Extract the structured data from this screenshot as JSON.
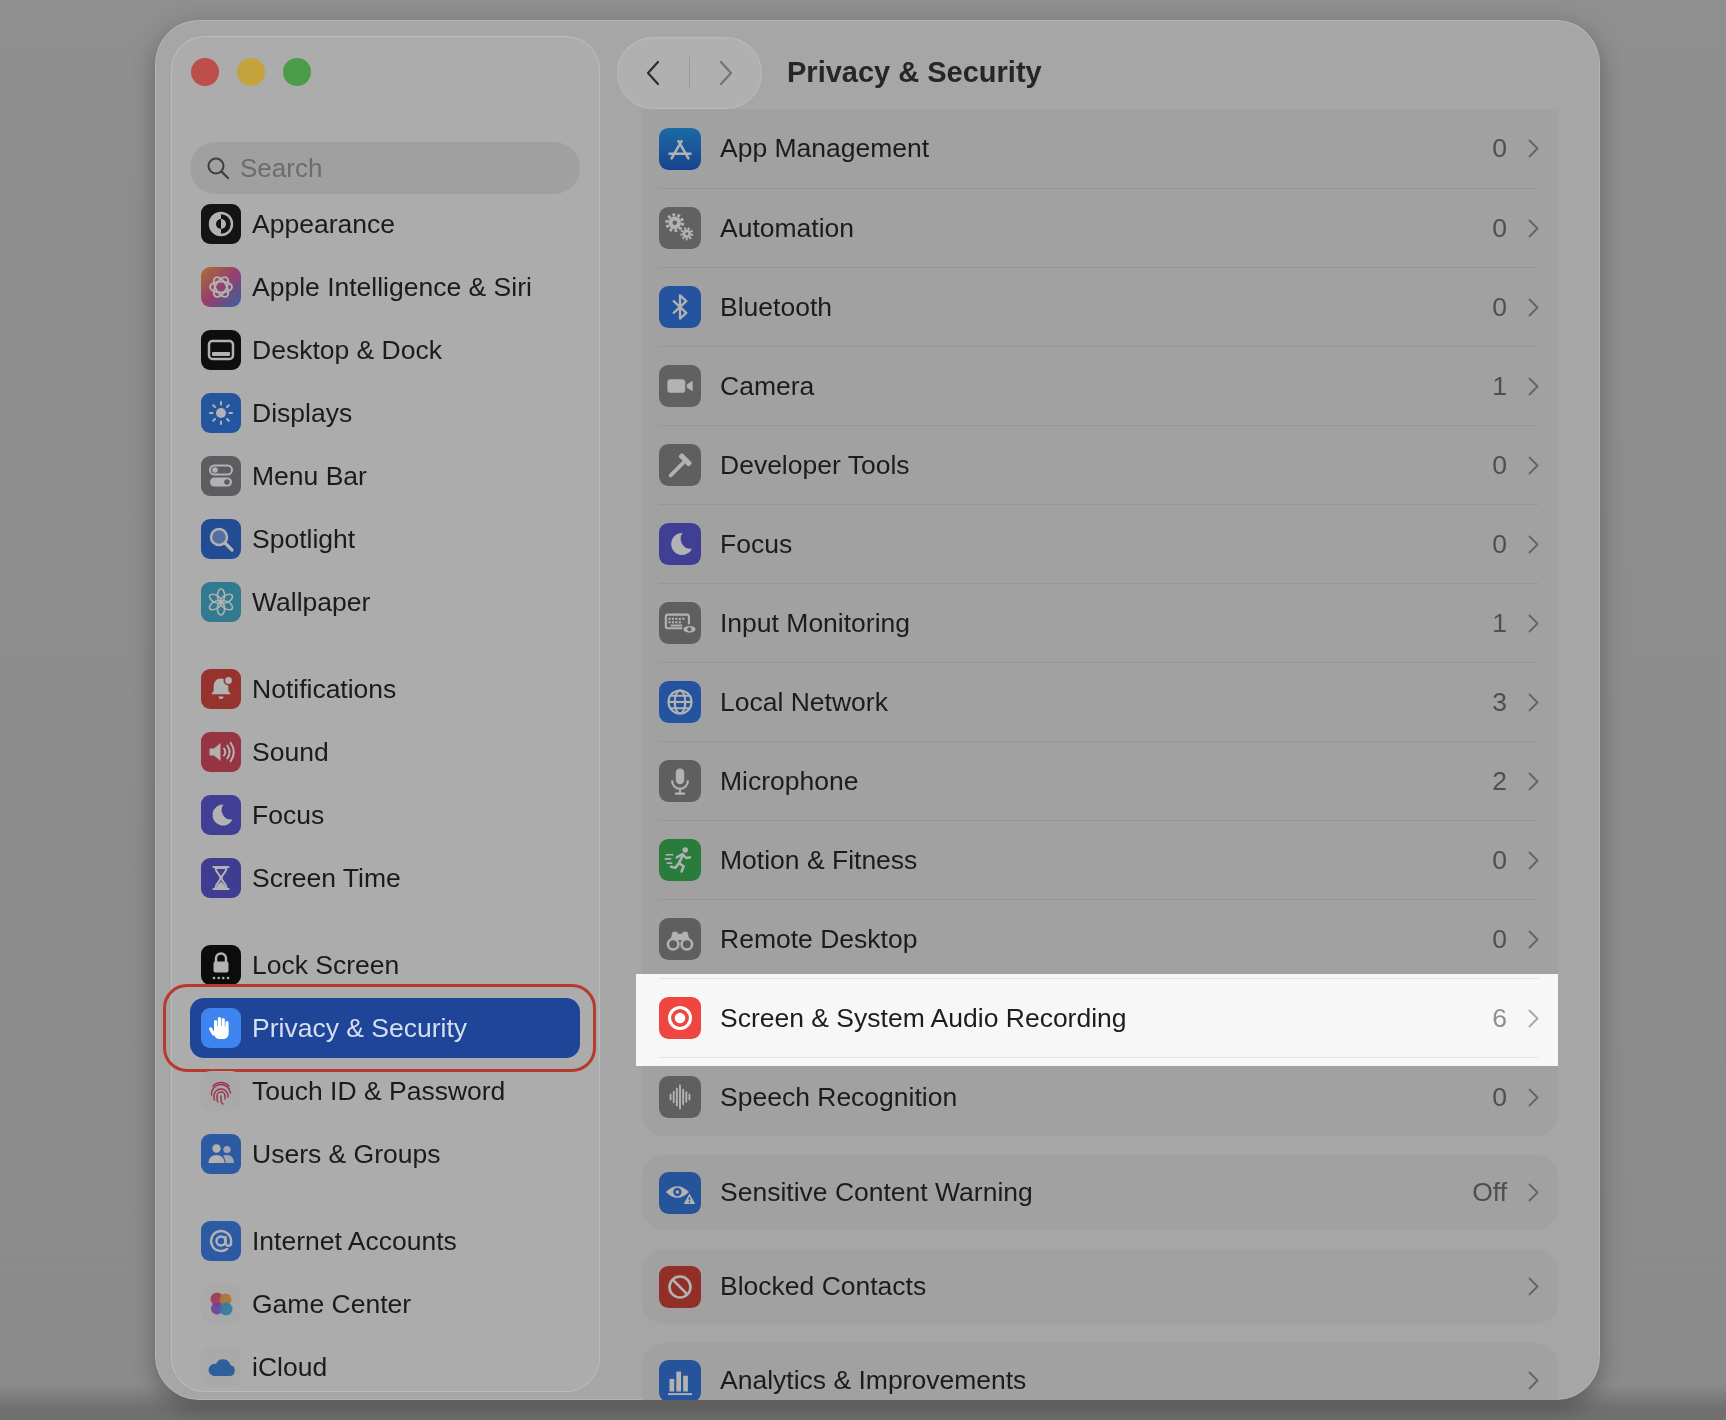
{
  "window": {
    "title": "Privacy & Security"
  },
  "nav": {
    "back_disabled": false,
    "forward_disabled": true
  },
  "sidebar": {
    "search": {
      "placeholder": "Search"
    },
    "groups": [
      {
        "items": [
          {
            "label": "Appearance",
            "selected": false,
            "circled": false
          },
          {
            "label": "Apple Intelligence & Siri",
            "selected": false,
            "circled": false
          },
          {
            "label": "Desktop & Dock",
            "selected": false,
            "circled": false
          },
          {
            "label": "Displays",
            "selected": false,
            "circled": false
          },
          {
            "label": "Menu Bar",
            "selected": false,
            "circled": false
          },
          {
            "label": "Spotlight",
            "selected": false,
            "circled": false
          },
          {
            "label": "Wallpaper",
            "selected": false,
            "circled": false
          }
        ]
      },
      {
        "items": [
          {
            "label": "Notifications",
            "selected": false,
            "circled": false
          },
          {
            "label": "Sound",
            "selected": false,
            "circled": false
          },
          {
            "label": "Focus",
            "selected": false,
            "circled": false
          },
          {
            "label": "Screen Time",
            "selected": false,
            "circled": false
          }
        ]
      },
      {
        "items": [
          {
            "label": "Lock Screen",
            "selected": false,
            "circled": false
          },
          {
            "label": "Privacy & Security",
            "selected": true,
            "circled": true
          },
          {
            "label": "Touch ID & Password",
            "selected": false,
            "circled": false
          },
          {
            "label": "Users & Groups",
            "selected": false,
            "circled": false
          }
        ]
      },
      {
        "items": [
          {
            "label": "Internet Accounts",
            "selected": false,
            "circled": false
          },
          {
            "label": "Game Center",
            "selected": false,
            "circled": false
          },
          {
            "label": "iCloud",
            "selected": false,
            "circled": false
          }
        ]
      }
    ]
  },
  "content": {
    "sections": [
      {
        "rows": [
          {
            "label": "App Management",
            "value": "0",
            "highlighted": false
          },
          {
            "label": "Automation",
            "value": "0",
            "highlighted": false
          },
          {
            "label": "Bluetooth",
            "value": "0",
            "highlighted": false
          },
          {
            "label": "Camera",
            "value": "1",
            "highlighted": false
          },
          {
            "label": "Developer Tools",
            "value": "0",
            "highlighted": false
          },
          {
            "label": "Focus",
            "value": "0",
            "highlighted": false
          },
          {
            "label": "Input Monitoring",
            "value": "1",
            "highlighted": false
          },
          {
            "label": "Local Network",
            "value": "3",
            "highlighted": false
          },
          {
            "label": "Microphone",
            "value": "2",
            "highlighted": false
          },
          {
            "label": "Motion & Fitness",
            "value": "0",
            "highlighted": false
          },
          {
            "label": "Remote Desktop",
            "value": "0",
            "highlighted": false
          },
          {
            "label": "Screen & System Audio Recording",
            "value": "6",
            "highlighted": true
          },
          {
            "label": "Speech Recognition",
            "value": "0",
            "highlighted": false
          }
        ]
      },
      {
        "rows": [
          {
            "label": "Sensitive Content Warning",
            "value": "Off",
            "highlighted": false
          }
        ]
      },
      {
        "rows": [
          {
            "label": "Blocked Contacts",
            "highlighted": false
          }
        ]
      },
      {
        "rows": [
          {
            "label": "Analytics & Improvements",
            "highlighted": false
          }
        ]
      }
    ]
  }
}
